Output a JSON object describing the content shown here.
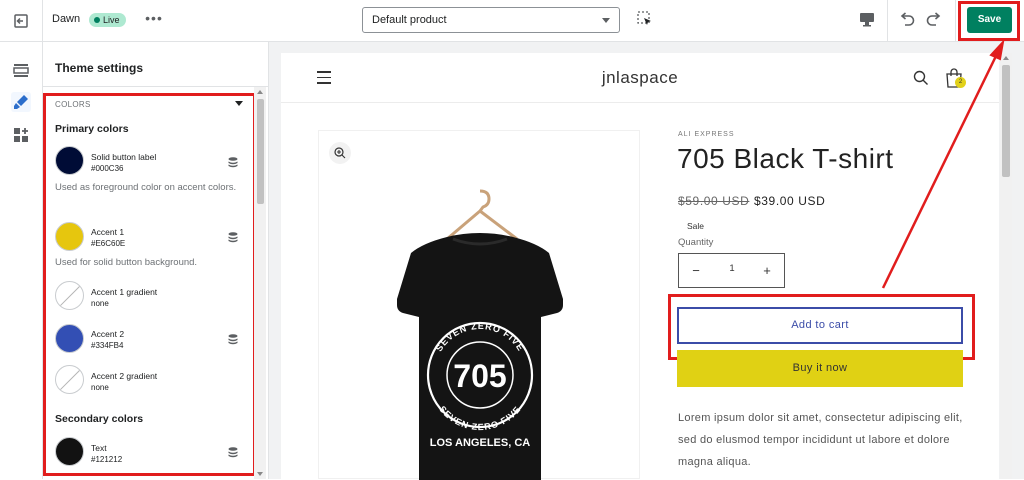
{
  "topbar": {
    "theme_name": "Dawn",
    "live_badge": "Live",
    "more_label": "•••",
    "template_select": "Default product",
    "save_label": "Save"
  },
  "settings": {
    "title": "Theme settings",
    "section": "COLORS",
    "primary_title": "Primary colors",
    "secondary_title": "Secondary colors",
    "swatches": [
      {
        "name": "Solid button label",
        "value": "#000C36",
        "color": "#000C36",
        "desc": "Used as foreground color on accent colors."
      },
      {
        "name": "Accent 1",
        "value": "#E6C60E",
        "color": "#E6C60E",
        "desc": "Used for solid button background."
      },
      {
        "name": "Accent 1 gradient",
        "value": "none",
        "color": "none"
      },
      {
        "name": "Accent 2",
        "value": "#334FB4",
        "color": "#334FB4"
      },
      {
        "name": "Accent 2 gradient",
        "value": "none",
        "color": "none"
      },
      {
        "name": "Text",
        "value": "#121212",
        "color": "#121212"
      }
    ]
  },
  "store": {
    "name": "jnlaspace",
    "cart_count": "2",
    "vendor": "ALI EXPRESS",
    "product_title": "705 Black T-shirt",
    "price_old": "$59.00 USD",
    "price_new": "$39.00 USD",
    "sale_label": "Sale",
    "quantity_label": "Quantity",
    "quantity_value": "1",
    "add_to_cart": "Add to cart",
    "buy_now": "Buy it now",
    "description": "Lorem ipsum dolor sit amet, consectetur adipiscing elit, sed do elusmod tempor incididunt ut labore et dolore magna aliqua.",
    "shirt_text": {
      "arc_top": "SEVEN ZERO FIVE",
      "number": "705",
      "arc_bottom": "SEVEN ZERO FIVE",
      "city": "LOS ANGELES, CA"
    }
  },
  "colors": {
    "save_green": "#008060",
    "highlight_red": "#E11D1D",
    "accent_yellow": "#E0D114",
    "button_blue": "#3B4CA8"
  }
}
